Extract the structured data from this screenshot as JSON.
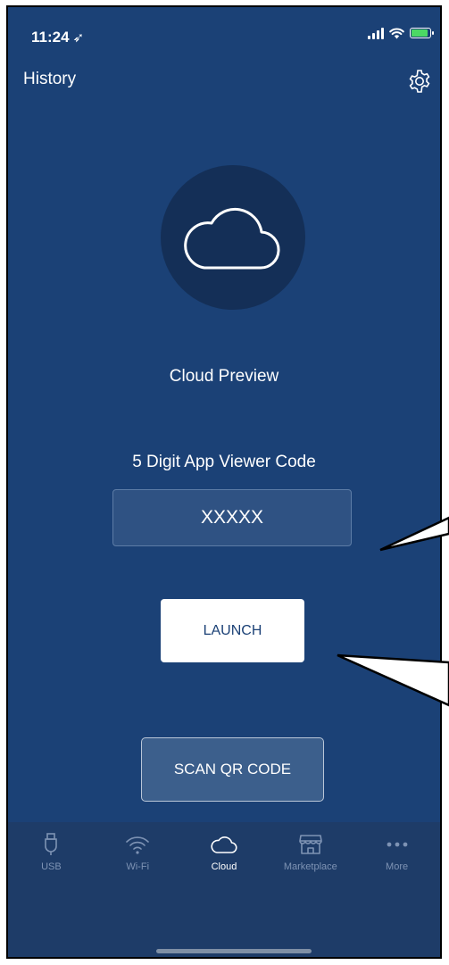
{
  "status_bar": {
    "time": "11:24",
    "location_glyph": "➶"
  },
  "header": {
    "left_label": "History",
    "settings_icon": "gear-icon"
  },
  "main": {
    "title": "Cloud Preview",
    "code_label": "5 Digit App Viewer Code",
    "code_placeholder": "XXXXX",
    "launch_label": "LAUNCH",
    "scan_label": "SCAN QR CODE"
  },
  "tabs": [
    {
      "label": "USB",
      "icon": "usb-icon",
      "active": false
    },
    {
      "label": "Wi-Fi",
      "icon": "wifi-icon",
      "active": false
    },
    {
      "label": "Cloud",
      "icon": "cloud-icon",
      "active": true
    },
    {
      "label": "Marketplace",
      "icon": "store-icon",
      "active": false
    },
    {
      "label": "More",
      "icon": "more-icon",
      "active": false
    }
  ],
  "colors": {
    "background": "#1b4176",
    "badge": "#142f57",
    "tab_active": "#ffffff",
    "tab_inactive": "#7e93b4"
  }
}
